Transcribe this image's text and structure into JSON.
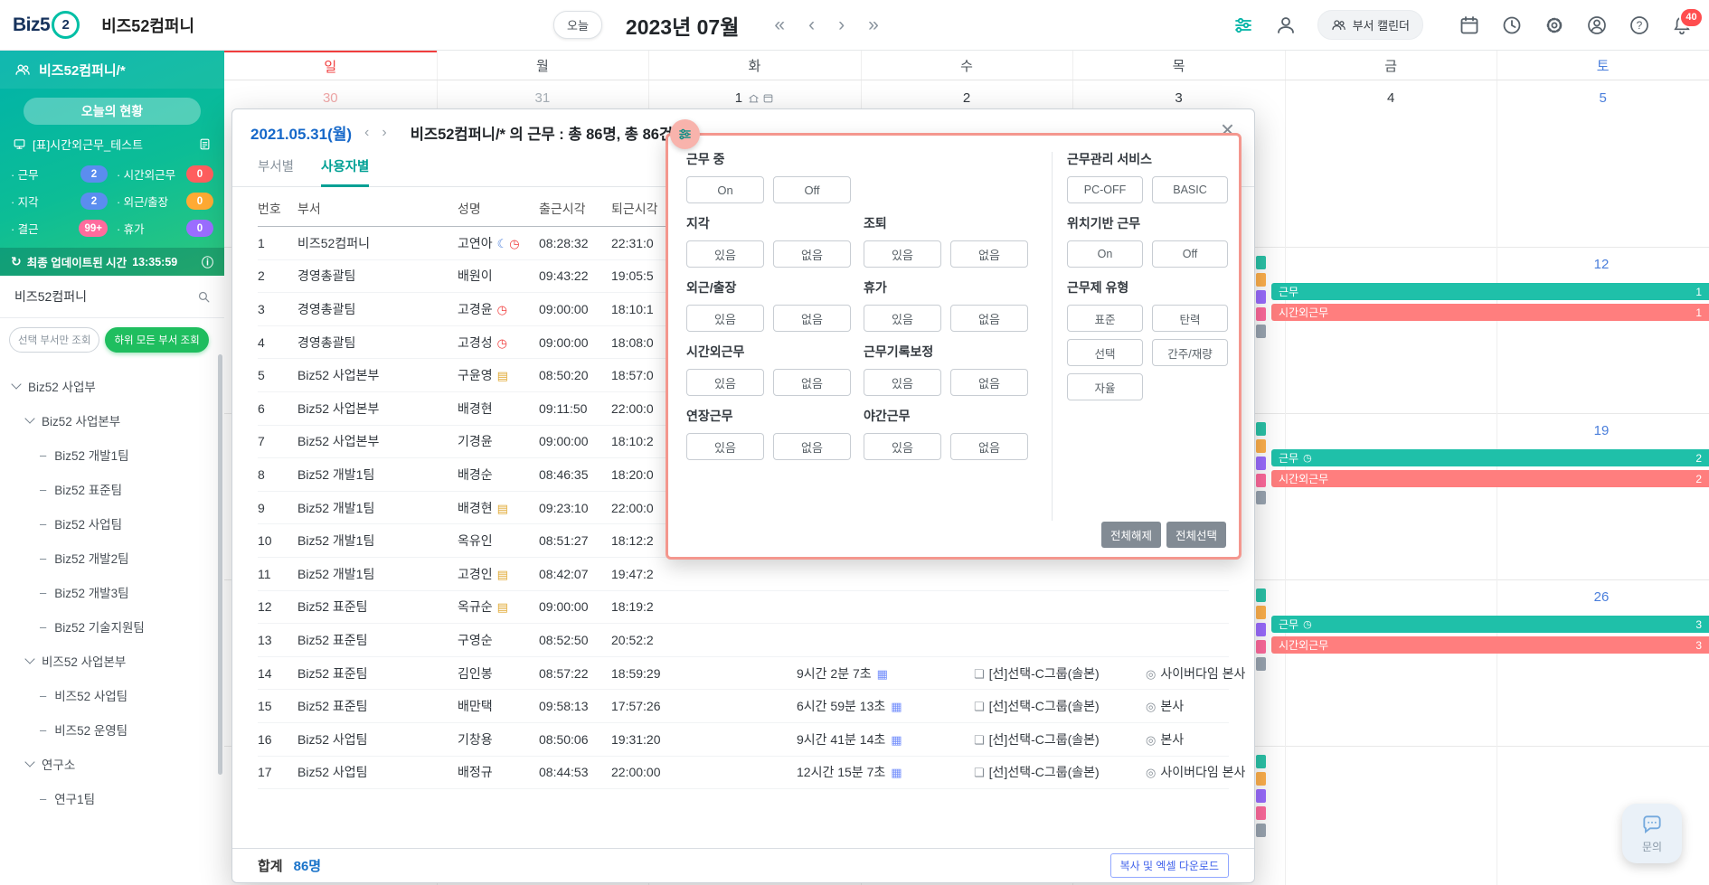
{
  "colors": {
    "primary_teal": "#00b2aa",
    "primary_green": "#2fc87c",
    "filter_highlight_border": "#f4978e",
    "work_chip": "#1fc0a9",
    "overtime_chip": "#ff7e7e",
    "sunday_red": "#f03e3e",
    "saturday_blue": "#4a7edb"
  },
  "topbar": {
    "logo": {
      "prefix": "Biz5",
      "suffix": "2"
    },
    "company_name": "비즈52컴퍼니",
    "today_button": "오늘",
    "month_title": "2023년 07월",
    "nav": {
      "first": "«",
      "prev": "‹",
      "next": "›",
      "last": "»"
    },
    "dept_calendar_button": "부서 캘린더",
    "notification_count": "40"
  },
  "sidebar": {
    "title": "비즈52컴퍼니/*",
    "today_status_label": "오늘의 현황",
    "report_label": "[표]시간외근무_테스트",
    "stats": [
      {
        "label": "근무",
        "value": "2",
        "color": "#5b8def"
      },
      {
        "label": "시간외근무",
        "value": "0",
        "color": "#ff5e5e"
      },
      {
        "label": "지각",
        "value": "2",
        "color": "#5b8def"
      },
      {
        "label": "외근/출장",
        "value": "0",
        "color": "#ffaa33"
      },
      {
        "label": "결근",
        "value": "99+",
        "color": "#ff6b9d"
      },
      {
        "label": "휴가",
        "value": "0",
        "color": "#9b6dff"
      }
    ],
    "last_update_label": "최종 업데이트된 시간",
    "last_update_time": "13:35:59",
    "search_value": "비즈52컴퍼니",
    "scope_buttons": [
      {
        "label": "선택 부서만 조회",
        "active": false
      },
      {
        "label": "하위 모든 부서 조회",
        "active": true
      }
    ],
    "tree": [
      {
        "label": "Biz52 사업부",
        "level": 0,
        "expandable": true
      },
      {
        "label": "Biz52 사업본부",
        "level": 1,
        "expandable": true
      },
      {
        "label": "Biz52 개발1팀",
        "level": 2,
        "expandable": false
      },
      {
        "label": "Biz52 표준팀",
        "level": 2,
        "expandable": false
      },
      {
        "label": "Biz52 사업팀",
        "level": 2,
        "expandable": false
      },
      {
        "label": "Biz52 개발2팀",
        "level": 2,
        "expandable": false
      },
      {
        "label": "Biz52 개발3팀",
        "level": 2,
        "expandable": false
      },
      {
        "label": "Biz52 기술지원팀",
        "level": 2,
        "expandable": false
      },
      {
        "label": "비즈52 사업본부",
        "level": 1,
        "expandable": true
      },
      {
        "label": "비즈52 사업팀",
        "level": 2,
        "expandable": false
      },
      {
        "label": "비즈52 운영팀",
        "level": 2,
        "expandable": false
      },
      {
        "label": "연구소",
        "level": 1,
        "expandable": true
      },
      {
        "label": "연구1팀",
        "level": 2,
        "expandable": false
      }
    ]
  },
  "calendar": {
    "day_headers": [
      {
        "label": "일",
        "type": "sunday"
      },
      {
        "label": "월",
        "type": "weekday"
      },
      {
        "label": "화",
        "type": "weekday"
      },
      {
        "label": "수",
        "type": "weekday"
      },
      {
        "label": "목",
        "type": "weekday"
      },
      {
        "label": "금",
        "type": "weekday"
      },
      {
        "label": "토",
        "type": "saturday"
      }
    ],
    "week1_dates": [
      {
        "day": "30",
        "cls": "sun-muted"
      },
      {
        "day": "31",
        "cls": "muted"
      },
      {
        "day": "1",
        "cls": "",
        "icons": true
      },
      {
        "day": "2",
        "cls": ""
      },
      {
        "day": "3",
        "cls": ""
      },
      {
        "day": "4",
        "cls": ""
      },
      {
        "day": "5",
        "cls": "sat"
      }
    ],
    "saturday_weeks": [
      {
        "date": "12",
        "events": [
          {
            "label": "근무",
            "count": "1",
            "type": "work",
            "clock": false
          },
          {
            "label": "시간외근무",
            "count": "1",
            "type": "overtime",
            "clock": false
          }
        ]
      },
      {
        "date": "19",
        "events": [
          {
            "label": "근무",
            "count": "2",
            "type": "work",
            "clock": true
          },
          {
            "label": "시간외근무",
            "count": "2",
            "type": "overtime",
            "clock": false
          }
        ]
      },
      {
        "date": "26",
        "events": [
          {
            "label": "근무",
            "count": "3",
            "type": "work",
            "clock": true
          },
          {
            "label": "시간외근무",
            "count": "3",
            "type": "overtime",
            "clock": false
          }
        ]
      }
    ],
    "clipped_chip_colors": [
      "#2bc3a8",
      "#ffb14d",
      "#9b6dff",
      "#ff6b9d",
      "#9aa5b1"
    ]
  },
  "modal": {
    "date_label": "2021.05.31(월)",
    "nav": {
      "prev": "‹",
      "next": "›"
    },
    "title": "비즈52컴퍼니/* 의 근무 : 총 86명, 총 86건",
    "close_glyph": "×",
    "tabs": [
      {
        "label": "부서별",
        "active": false
      },
      {
        "label": "사용자별",
        "active": true
      }
    ],
    "table": {
      "columns": [
        "번호",
        "부서",
        "성명",
        "출근시각",
        "퇴근시각",
        "",
        "",
        ""
      ],
      "rows": [
        {
          "no": "1",
          "dept": "비즈52컴퍼니",
          "name": "고연아",
          "icons": [
            "moon",
            "clock"
          ],
          "in": "08:28:32",
          "out": "22:31:0",
          "dur": "",
          "sched": "",
          "loc": ""
        },
        {
          "no": "2",
          "dept": "경영총괄팀",
          "name": "배원이",
          "icons": [],
          "in": "09:43:22",
          "out": "19:05:5",
          "dur": "",
          "sched": "",
          "loc": ""
        },
        {
          "no": "3",
          "dept": "경영총괄팀",
          "name": "고경윤",
          "icons": [
            "clock"
          ],
          "in": "09:00:00",
          "out": "18:10:1",
          "dur": "",
          "sched": "",
          "loc": ""
        },
        {
          "no": "4",
          "dept": "경영총괄팀",
          "name": "고경성",
          "icons": [
            "clock"
          ],
          "in": "09:00:00",
          "out": "18:08:0",
          "dur": "",
          "sched": "",
          "loc": ""
        },
        {
          "no": "5",
          "dept": "Biz52 사업본부",
          "name": "구윤영",
          "icons": [
            "note"
          ],
          "in": "08:50:20",
          "out": "18:57:0",
          "dur": "",
          "sched": "",
          "loc": ""
        },
        {
          "no": "6",
          "dept": "Biz52 사업본부",
          "name": "배경현",
          "icons": [],
          "in": "09:11:50",
          "out": "22:00:0",
          "dur": "",
          "sched": "",
          "loc": ""
        },
        {
          "no": "7",
          "dept": "Biz52 사업본부",
          "name": "기경윤",
          "icons": [],
          "in": "09:00:00",
          "out": "18:10:2",
          "dur": "",
          "sched": "",
          "loc": ""
        },
        {
          "no": "8",
          "dept": "Biz52 개발1팀",
          "name": "배경순",
          "icons": [],
          "in": "08:46:35",
          "out": "18:20:0",
          "dur": "",
          "sched": "",
          "loc": ""
        },
        {
          "no": "9",
          "dept": "Biz52 개발1팀",
          "name": "배경현",
          "icons": [
            "note"
          ],
          "in": "09:23:10",
          "out": "22:00:0",
          "dur": "",
          "sched": "",
          "loc": ""
        },
        {
          "no": "10",
          "dept": "Biz52 개발1팀",
          "name": "옥유인",
          "icons": [],
          "in": "08:51:27",
          "out": "18:12:2",
          "dur": "",
          "sched": "",
          "loc": ""
        },
        {
          "no": "11",
          "dept": "Biz52 개발1팀",
          "name": "고경인",
          "icons": [
            "note"
          ],
          "in": "08:42:07",
          "out": "19:47:2",
          "dur": "",
          "sched": "",
          "loc": ""
        },
        {
          "no": "12",
          "dept": "Biz52 표준팀",
          "name": "옥규순",
          "icons": [
            "note"
          ],
          "in": "09:00:00",
          "out": "18:19:2",
          "dur": "",
          "sched": "",
          "loc": ""
        },
        {
          "no": "13",
          "dept": "Biz52 표준팀",
          "name": "구영순",
          "icons": [],
          "in": "08:52:50",
          "out": "20:52:2",
          "dur": "",
          "sched": "",
          "loc": ""
        },
        {
          "no": "14",
          "dept": "Biz52 표준팀",
          "name": "김인봉",
          "icons": [],
          "in": "08:57:22",
          "out": "18:59:29",
          "dur": "9시간 2분 7초",
          "sched": "[선]선택-C그룹(솔본)",
          "loc": "사이버다임 본사"
        },
        {
          "no": "15",
          "dept": "Biz52 표준팀",
          "name": "배만택",
          "icons": [],
          "in": "09:58:13",
          "out": "17:57:26",
          "dur": "6시간 59분 13초",
          "sched": "[선]선택-C그룹(솔본)",
          "loc": "본사"
        },
        {
          "no": "16",
          "dept": "Biz52 사업팀",
          "name": "기창용",
          "icons": [],
          "in": "08:50:06",
          "out": "19:31:20",
          "dur": "9시간 41분 14초",
          "sched": "[선]선택-C그룹(솔본)",
          "loc": "본사"
        },
        {
          "no": "17",
          "dept": "Biz52 사업팀",
          "name": "배정규",
          "icons": [],
          "in": "08:44:53",
          "out": "22:00:00",
          "dur": "12시간 15분 7초",
          "sched": "[선]선택-C그룹(솔본)",
          "loc": "사이버다임 본사"
        }
      ],
      "total_label": "합계",
      "total_value": "86명",
      "download_button": "복사 및 엑셀 다운로드"
    }
  },
  "filter_panel": {
    "groups": [
      {
        "title": "근무 중",
        "col": 1,
        "options": [
          "On",
          "Off"
        ]
      },
      {
        "title": "근무관리 서비스",
        "col": 3,
        "options": [
          "PC-OFF",
          "BASIC"
        ]
      },
      {
        "title": "지각",
        "col": 1,
        "options": [
          "있음",
          "없음"
        ]
      },
      {
        "title": "조퇴",
        "col": 2,
        "options": [
          "있음",
          "없음"
        ]
      },
      {
        "title": "위치기반 근무",
        "col": 3,
        "options": [
          "On",
          "Off"
        ]
      },
      {
        "title": "외근/출장",
        "col": 1,
        "options": [
          "있음",
          "없음"
        ]
      },
      {
        "title": "휴가",
        "col": 2,
        "options": [
          "있음",
          "없음"
        ]
      },
      {
        "title": "근무제 유형",
        "col": 3,
        "options": [
          "표준",
          "탄력",
          "선택",
          "간주/재량",
          "자율"
        ]
      },
      {
        "title": "시간외근무",
        "col": 1,
        "options": [
          "있음",
          "없음"
        ]
      },
      {
        "title": "근무기록보정",
        "col": 2,
        "options": [
          "있음",
          "없음"
        ]
      },
      {
        "title": "연장근무",
        "col": 1,
        "options": [
          "있음",
          "없음"
        ]
      },
      {
        "title": "야간근무",
        "col": 2,
        "options": [
          "있음",
          "없음"
        ]
      }
    ],
    "deselect_all_button": "전체해제",
    "select_all_button": "전체선택"
  },
  "chat_button_label": "문의"
}
